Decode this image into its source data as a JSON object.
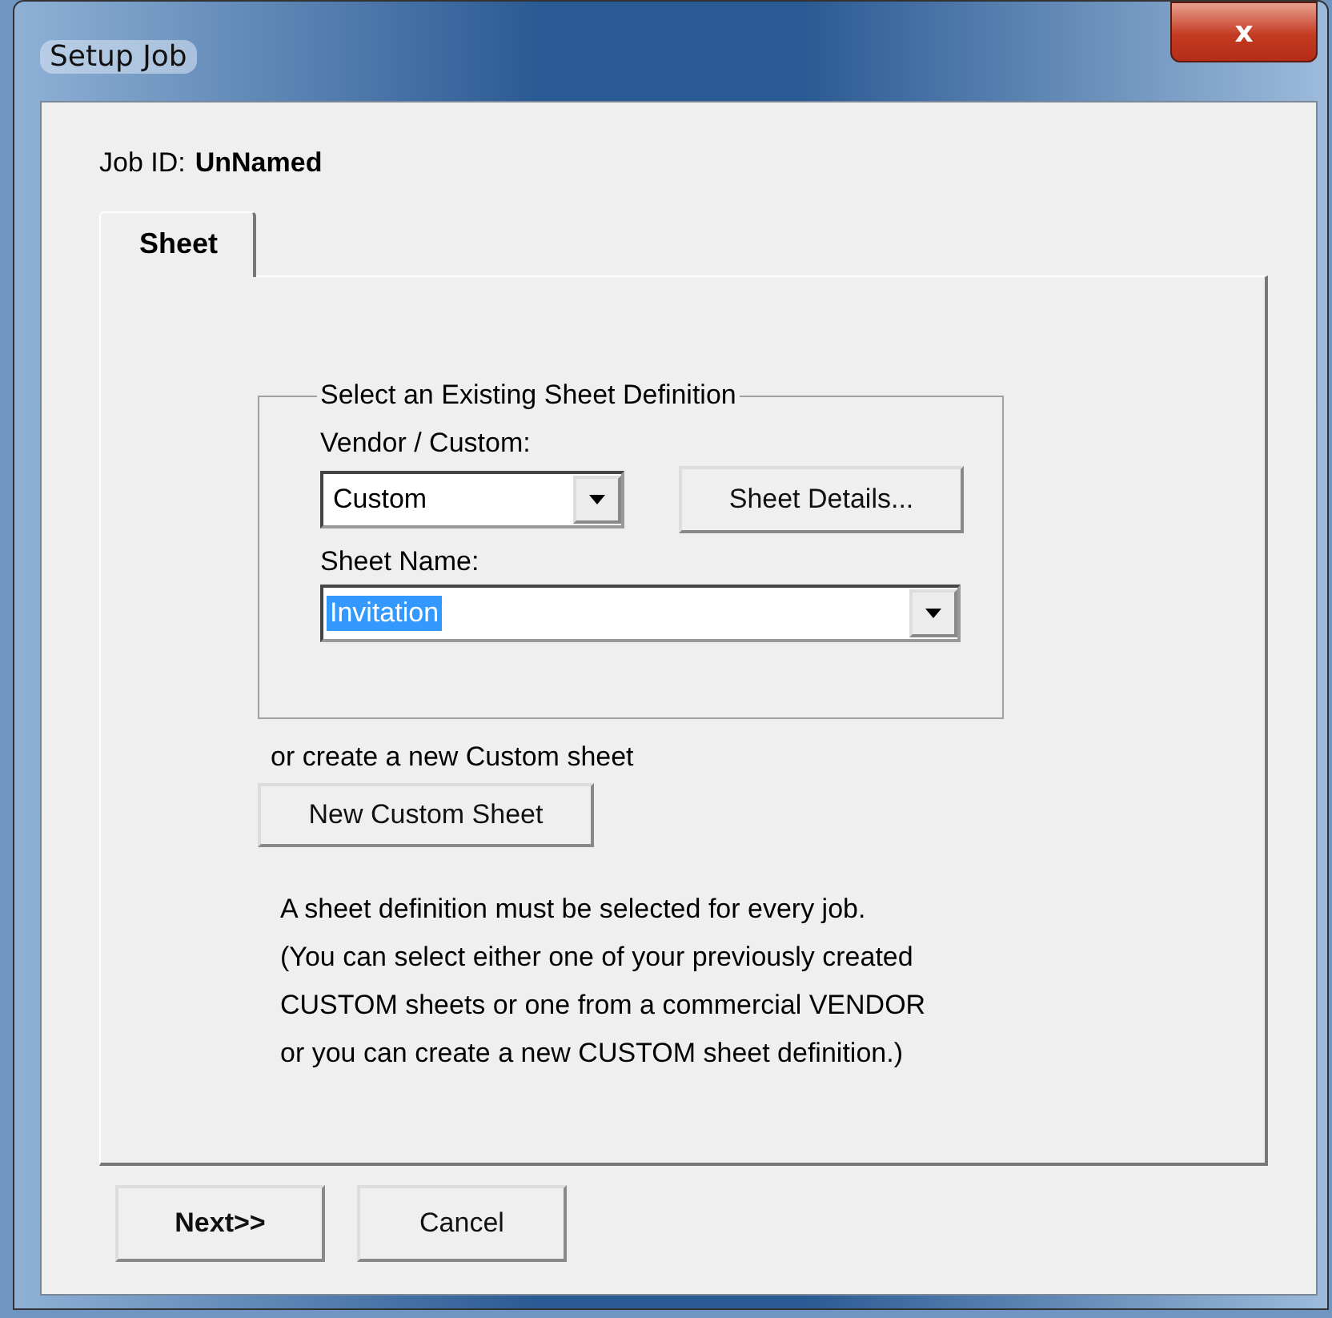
{
  "window": {
    "title": "Setup Job",
    "close": "x"
  },
  "job_id": {
    "label": "Job ID:",
    "value": "UnNamed"
  },
  "tabs": [
    {
      "label": "Sheet",
      "selected": true
    }
  ],
  "group": {
    "title": "Select an Existing Sheet Definition",
    "vendor": {
      "label": "Vendor / Custom:",
      "value": "Custom"
    },
    "details_button": "Sheet Details...",
    "sheet_name": {
      "label": "Sheet Name:",
      "value": "Invitation",
      "text_selected": true
    }
  },
  "create_hint": "or create a new Custom sheet",
  "new_button": "New Custom Sheet",
  "note": [
    "A sheet definition must be selected for every job.",
    "(You can select either one of your previously created\nCUSTOM sheets or one from a commercial VENDOR\nor you can create a new CUSTOM sheet definition.)"
  ],
  "buttons": [
    {
      "label": "Next>>",
      "default": true
    },
    {
      "label": "Cancel",
      "default": false
    }
  ]
}
